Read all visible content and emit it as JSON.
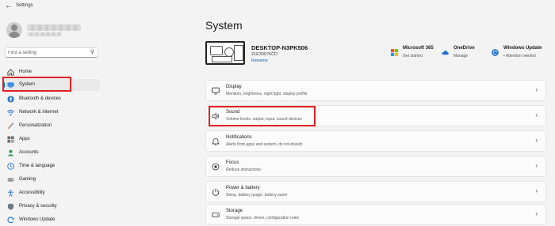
{
  "window": {
    "title": "Settings",
    "back_icon": "arrow-left-icon"
  },
  "search": {
    "placeholder": "Find a setting"
  },
  "sidebar": {
    "items": [
      {
        "label": "Home",
        "icon": "home-icon"
      },
      {
        "label": "System",
        "icon": "system-icon",
        "active": true
      },
      {
        "label": "Bluetooth & devices",
        "icon": "bluetooth-icon"
      },
      {
        "label": "Network & internet",
        "icon": "network-icon"
      },
      {
        "label": "Personalization",
        "icon": "brush-icon"
      },
      {
        "label": "Apps",
        "icon": "apps-icon"
      },
      {
        "label": "Accounts",
        "icon": "accounts-icon"
      },
      {
        "label": "Time & language",
        "icon": "globe-clock-icon"
      },
      {
        "label": "Gaming",
        "icon": "gamepad-icon"
      },
      {
        "label": "Accessibility",
        "icon": "accessibility-icon"
      },
      {
        "label": "Privacy & security",
        "icon": "shield-icon"
      },
      {
        "label": "Windows Update",
        "icon": "windows-update-icon"
      }
    ]
  },
  "page": {
    "title": "System"
  },
  "device": {
    "name": "DESKTOP-N3PK506",
    "id": "21E30076CD",
    "rename_label": "Rename"
  },
  "status": [
    {
      "title": "Microsoft 365",
      "subtitle": "Get started",
      "icon": "microsoft-logo-icon"
    },
    {
      "title": "OneDrive",
      "subtitle": "Manage",
      "icon": "cloud-icon"
    },
    {
      "title": "Windows Update",
      "subtitle": "• Attention needed",
      "icon": "update-sync-icon"
    }
  ],
  "cards": [
    {
      "title": "Display",
      "subtitle": "Monitors, brightness, night light, display profile",
      "icon": "monitor-icon"
    },
    {
      "title": "Sound",
      "subtitle": "Volume levels, output, input, sound devices",
      "icon": "speaker-icon"
    },
    {
      "title": "Notifications",
      "subtitle": "Alerts from apps and system, do not disturb",
      "icon": "bell-icon"
    },
    {
      "title": "Focus",
      "subtitle": "Reduce distractions",
      "icon": "focus-icon"
    },
    {
      "title": "Power & battery",
      "subtitle": "Sleep, battery usage, battery saver",
      "icon": "power-icon"
    },
    {
      "title": "Storage",
      "subtitle": "Storage space, drives, configuration rules",
      "icon": "storage-icon"
    }
  ],
  "colors": {
    "accent": "#0067c0",
    "highlight": "#e02020",
    "background": "#f3f3f3"
  }
}
